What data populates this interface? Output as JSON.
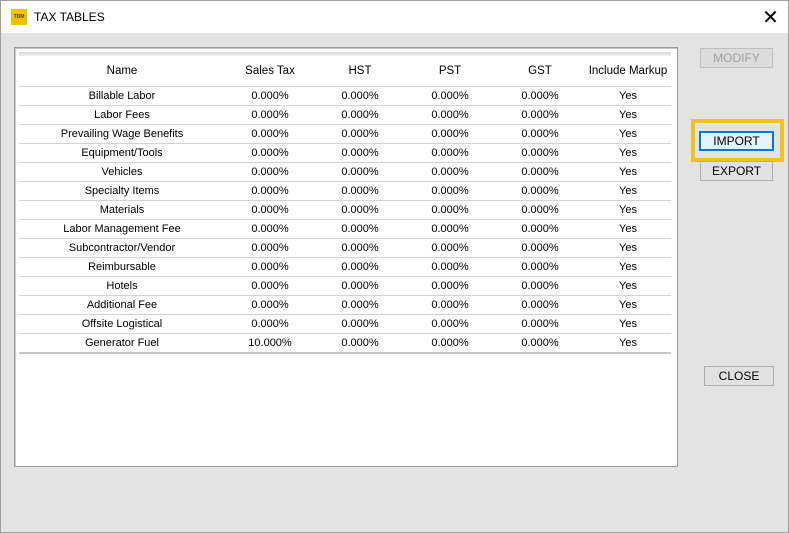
{
  "window": {
    "title": "TAX TABLES",
    "app_icon_text": "TBM",
    "close_glyph": "✕"
  },
  "table": {
    "columns": [
      "Name",
      "Sales Tax",
      "HST",
      "PST",
      "GST",
      "Include Markup"
    ],
    "rows": [
      [
        "Billable Labor",
        "0.000%",
        "0.000%",
        "0.000%",
        "0.000%",
        "Yes"
      ],
      [
        "Labor Fees",
        "0.000%",
        "0.000%",
        "0.000%",
        "0.000%",
        "Yes"
      ],
      [
        "Prevailing Wage Benefits",
        "0.000%",
        "0.000%",
        "0.000%",
        "0.000%",
        "Yes"
      ],
      [
        "Equipment/Tools",
        "0.000%",
        "0.000%",
        "0.000%",
        "0.000%",
        "Yes"
      ],
      [
        "Vehicles",
        "0.000%",
        "0.000%",
        "0.000%",
        "0.000%",
        "Yes"
      ],
      [
        "Specialty Items",
        "0.000%",
        "0.000%",
        "0.000%",
        "0.000%",
        "Yes"
      ],
      [
        "Materials",
        "0.000%",
        "0.000%",
        "0.000%",
        "0.000%",
        "Yes"
      ],
      [
        "Labor Management Fee",
        "0.000%",
        "0.000%",
        "0.000%",
        "0.000%",
        "Yes"
      ],
      [
        "Subcontractor/Vendor",
        "0.000%",
        "0.000%",
        "0.000%",
        "0.000%",
        "Yes"
      ],
      [
        "Reimbursable",
        "0.000%",
        "0.000%",
        "0.000%",
        "0.000%",
        "Yes"
      ],
      [
        "Hotels",
        "0.000%",
        "0.000%",
        "0.000%",
        "0.000%",
        "Yes"
      ],
      [
        "Additional Fee",
        "0.000%",
        "0.000%",
        "0.000%",
        "0.000%",
        "Yes"
      ],
      [
        "Offsite Logistical",
        "0.000%",
        "0.000%",
        "0.000%",
        "0.000%",
        "Yes"
      ],
      [
        "Generator Fuel",
        "10.000%",
        "0.000%",
        "0.000%",
        "0.000%",
        "Yes"
      ]
    ]
  },
  "buttons": {
    "modify": "MODIFY",
    "import": "IMPORT",
    "export": "EXPORT",
    "close": "CLOSE"
  },
  "colors": {
    "highlight": "#f0c21e",
    "focus_border": "#0078d7",
    "app_icon": "#f2c200"
  }
}
